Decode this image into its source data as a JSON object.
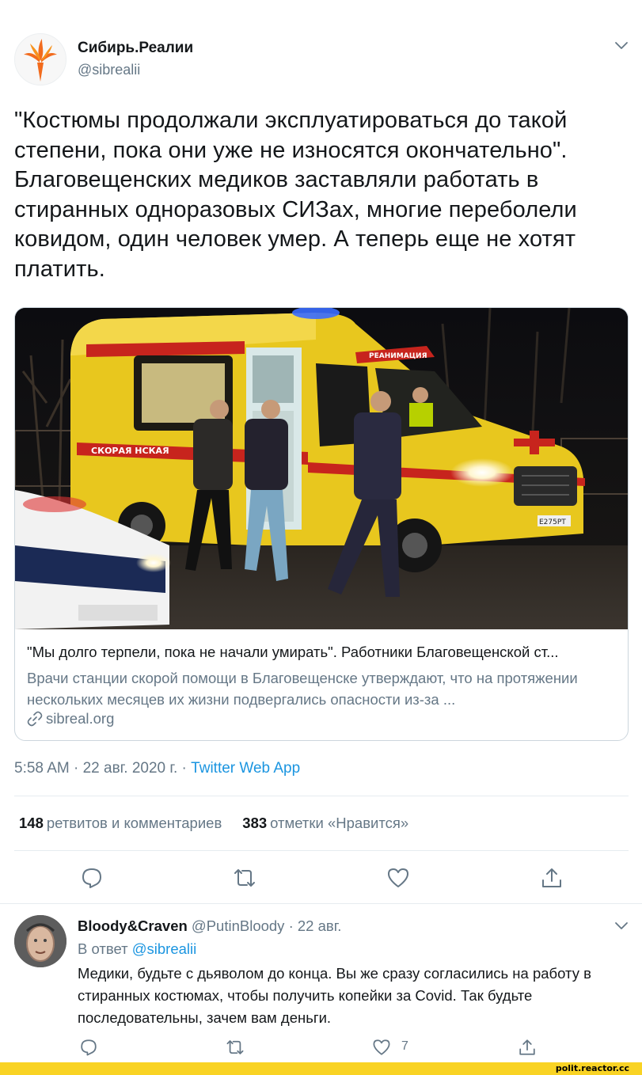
{
  "tweet": {
    "author": {
      "name": "Сибирь.Реалии",
      "handle": "@sibrealii"
    },
    "text": "\"Костюмы продолжали эксплуатироваться до такой степени, пока они уже не износятся окончательно\". Благовещенских медиков заставляли работать в стиранных одноразовых СИЗах, многие переболели ковидом, один человек умер. А теперь еще не хотят платить.",
    "card": {
      "image_text": {
        "side_label": "СКОРАЯ НСКАЯ",
        "top_label": "РЕАНИМАЦИЯ",
        "plate": "Е275РТ"
      },
      "title": "\"Мы долго терпели, пока не начали умирать\". Работники Благовещенской ст...",
      "description": "Врачи станции скорой помощи в Благовещенске утверждают, что на протяжении нескольких месяцев их жизни подвергались опасности из-за ...",
      "link": "sibreal.org"
    },
    "time": "5:58 AM · 22 авг. 2020 г. · ",
    "app": "Twitter Web App",
    "stats": {
      "retweets_count": "148",
      "retweets_label": "ретвитов и комментариев",
      "likes_count": "383",
      "likes_label": "отметки «Нравится»"
    }
  },
  "reply": {
    "name": "Bloody&Craven",
    "handle": "@PutinBloody",
    "date": " · 22 авг.",
    "replying_to_label": "В ответ ",
    "replying_to_mention": "@sibrealii",
    "text": "Медики, будьте с дьяволом до конца. Вы же сразу согласились на работу в стиранных костюмах, чтобы получить копейки за Covid. Так будьте последовательны, зачем вам деньги.",
    "like_count": "7"
  },
  "watermark": "polit.reactor.cc",
  "colors": {
    "accent": "#1b95e0",
    "muted": "#657786",
    "text": "#14171a",
    "watermark_bg": "#f9d324",
    "logo": "#f26b1d"
  },
  "icons": [
    "logo-icon",
    "chevron-down-icon",
    "reply-icon",
    "retweet-icon",
    "like-icon",
    "share-icon",
    "link-icon"
  ]
}
